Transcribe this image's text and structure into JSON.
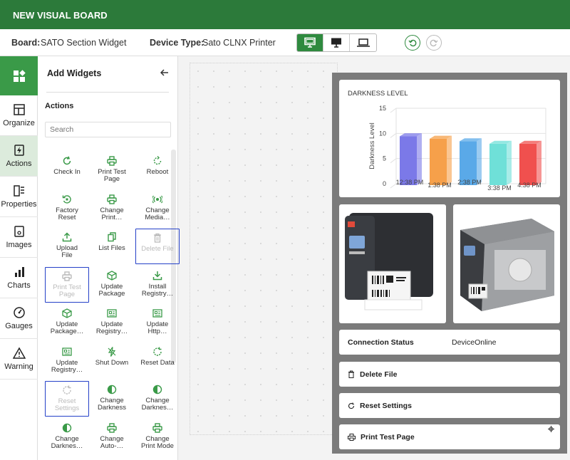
{
  "app": {
    "title": "NEW VISUAL BOARD"
  },
  "boardbar": {
    "board_label": "Board:",
    "board_value": "SATO Section Widget",
    "device_label": "Device Type:",
    "device_value": "Sato CLNX Printer"
  },
  "nav": [
    {
      "label": "Organize",
      "icon": "layout-icon"
    },
    {
      "label": "Actions",
      "icon": "bolt-icon"
    },
    {
      "label": "Properties",
      "icon": "properties-icon"
    },
    {
      "label": "Images",
      "icon": "image-icon"
    },
    {
      "label": "Charts",
      "icon": "bar-chart-icon"
    },
    {
      "label": "Gauges",
      "icon": "gauge-icon"
    },
    {
      "label": "Warning",
      "icon": "warning-icon"
    }
  ],
  "panel": {
    "title": "Add Widgets",
    "section": "Actions",
    "search_placeholder": "Search",
    "widgets": [
      {
        "l1": "Check In",
        "l2": "",
        "icon": "refresh-icon"
      },
      {
        "l1": "Print Test",
        "l2": "Page",
        "icon": "printer-icon"
      },
      {
        "l1": "Reboot",
        "l2": "",
        "icon": "reboot-icon"
      },
      {
        "l1": "Factory",
        "l2": "Reset",
        "icon": "factory-reset-icon"
      },
      {
        "l1": "Change",
        "l2": "Print…",
        "icon": "printer-icon"
      },
      {
        "l1": "Change",
        "l2": "Media…",
        "icon": "media-icon"
      },
      {
        "l1": "Upload",
        "l2": "File",
        "icon": "upload-icon"
      },
      {
        "l1": "List Files",
        "l2": "",
        "icon": "files-icon"
      },
      {
        "l1": "Delete File",
        "l2": "",
        "icon": "trash-icon"
      },
      {
        "l1": "Print Test",
        "l2": "Page",
        "icon": "printer-icon"
      },
      {
        "l1": "Update",
        "l2": "Package",
        "icon": "package-icon"
      },
      {
        "l1": "Install",
        "l2": "Registry…",
        "icon": "download-icon"
      },
      {
        "l1": "Update",
        "l2": "Package…",
        "icon": "package-icon"
      },
      {
        "l1": "Update",
        "l2": "Registry…",
        "icon": "registry-icon"
      },
      {
        "l1": "Update",
        "l2": "Http…",
        "icon": "registry-icon"
      },
      {
        "l1": "Update",
        "l2": "Registry…",
        "icon": "registry-icon"
      },
      {
        "l1": "Shut Down",
        "l2": "",
        "icon": "power-icon"
      },
      {
        "l1": "Reset Data",
        "l2": "",
        "icon": "reset-icon"
      },
      {
        "l1": "Reset",
        "l2": "Settings",
        "icon": "reset-icon"
      },
      {
        "l1": "Change",
        "l2": "Darkness",
        "icon": "contrast-icon"
      },
      {
        "l1": "Change",
        "l2": "Darknes…",
        "icon": "contrast-icon"
      },
      {
        "l1": "Change",
        "l2": "Darknes…",
        "icon": "contrast-icon"
      },
      {
        "l1": "Change",
        "l2": "Auto-…",
        "icon": "printer-icon"
      },
      {
        "l1": "Change",
        "l2": "Print Mode",
        "icon": "printer-icon"
      }
    ]
  },
  "board": {
    "connection_label": "Connection Status",
    "connection_value": "DeviceOnline",
    "actions": [
      {
        "label": "Delete File",
        "icon": "trash-icon"
      },
      {
        "label": "Reset Settings",
        "icon": "reset-icon"
      },
      {
        "label": "Print Test Page",
        "icon": "printer-icon"
      }
    ]
  },
  "chart_data": {
    "type": "bar",
    "title": "DARKNESS LEVEL",
    "ylabel": "Darkness Level",
    "xlabel": "",
    "categories": [
      "12:38 PM",
      "1:38 PM",
      "2:38 PM",
      "3:38 PM",
      "4:38 PM"
    ],
    "values": [
      10,
      9.5,
      9,
      8.5,
      8.5
    ],
    "colors": [
      "#7b79e8",
      "#f6a04a",
      "#5aa9e8",
      "#6fe0d8",
      "#f0504e"
    ],
    "yticks": [
      0,
      5,
      10,
      15
    ],
    "ylim": [
      0,
      15
    ],
    "grid": true
  },
  "colors": {
    "brand": "#2c7a3a",
    "accent": "#3a9a48"
  }
}
